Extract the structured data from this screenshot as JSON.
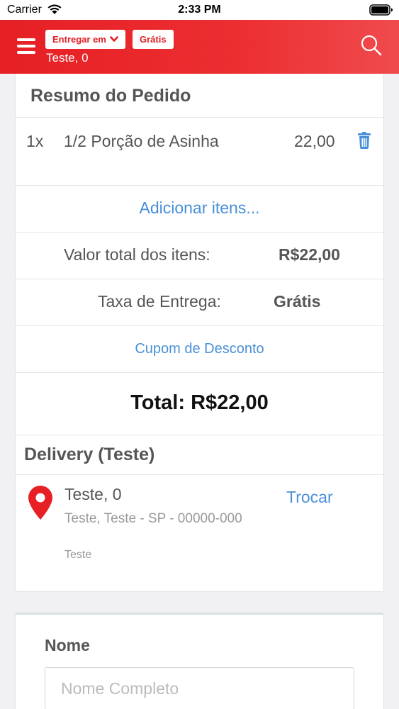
{
  "status_bar": {
    "carrier": "Carrier",
    "time": "2:33 PM"
  },
  "header": {
    "deliver_label": "Entregar em",
    "fee_badge": "Grátis",
    "address": "Teste, 0",
    "accent_color": "#e62025"
  },
  "summary": {
    "title": "Resumo do Pedido",
    "items": [
      {
        "qty": "1x",
        "name": "1/2 Porção de Asinha",
        "price": "22,00"
      }
    ],
    "add_items_label": "Adicionar itens...",
    "subtotal_label": "Valor total dos itens:",
    "subtotal_value": "R$22,00",
    "delivery_fee_label": "Taxa de Entrega:",
    "delivery_fee_value": "Grátis",
    "coupon_label": "Cupom de Desconto",
    "total_text": "Total: R$22,00"
  },
  "delivery": {
    "title": "Delivery (Teste)",
    "address_name": "Teste, 0",
    "address_line": "Teste, Teste - SP - 00000-000",
    "address_note": "Teste",
    "change_label": "Trocar"
  },
  "form": {
    "name_label": "Nome",
    "name_placeholder": "Nome Completo",
    "name_value": ""
  },
  "icons": {
    "menu": "menu-icon",
    "search": "search-icon",
    "trash": "trash-icon",
    "pin": "map-pin-icon",
    "chevron": "chevron-down-icon"
  }
}
